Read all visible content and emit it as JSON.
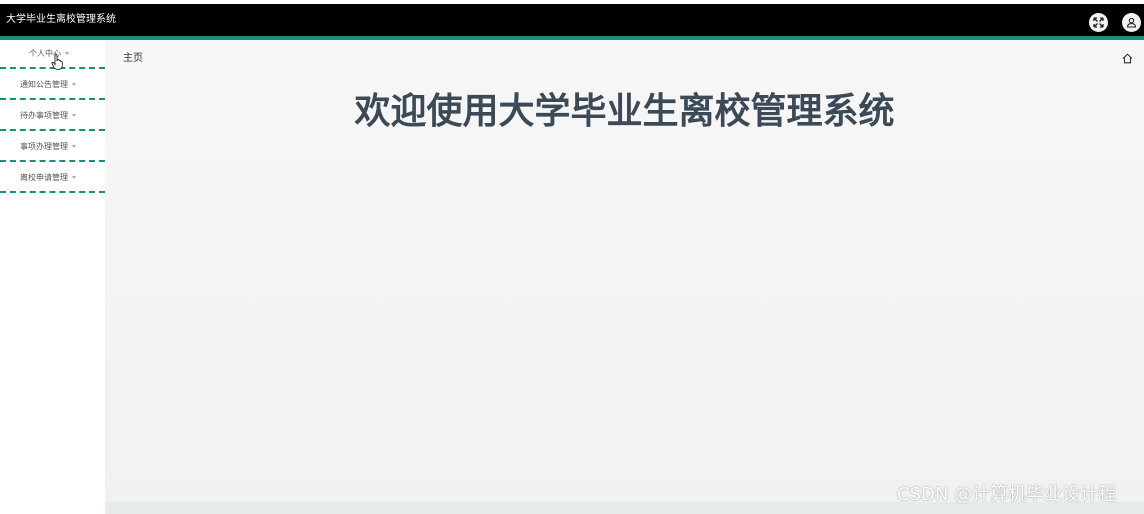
{
  "app": {
    "title": "大学毕业生离校管理系统"
  },
  "header": {
    "icons": [
      "expand-icon",
      "user-icon"
    ]
  },
  "sidebar": {
    "items": [
      {
        "label": "个人中心",
        "icon": "chevron-down-icon"
      },
      {
        "label": "通知公告管理",
        "icon": "chevron-down-icon"
      },
      {
        "label": "待办事项管理",
        "icon": "chevron-down-icon"
      },
      {
        "label": "事项办理管理",
        "icon": "chevron-down-icon"
      },
      {
        "label": "离校申请管理",
        "icon": "chevron-down-icon"
      }
    ]
  },
  "main": {
    "breadcrumb": "主页",
    "welcome": "欢迎使用大学毕业生离校管理系统"
  },
  "watermark": {
    "text": "CSDN @计算机毕业设计程"
  },
  "colors": {
    "topbar": "#000000",
    "accent": "#17907d",
    "welcome_text": "#3c4a57"
  }
}
